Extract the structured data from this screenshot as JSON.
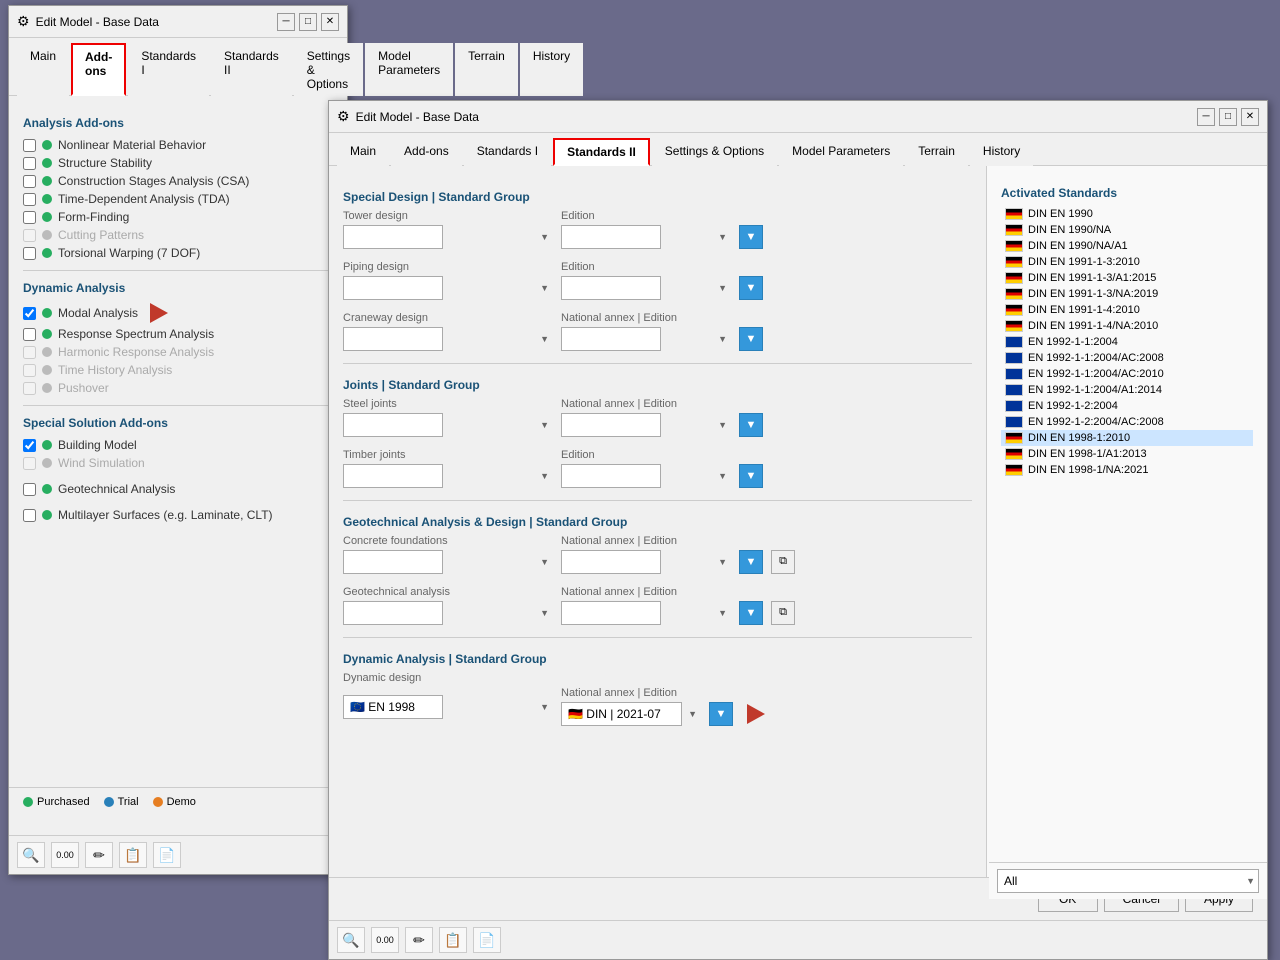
{
  "window1": {
    "title": "Edit Model - Base Data",
    "tabs": [
      "Main",
      "Add-ons",
      "Standards I",
      "Standards II",
      "Settings & Options",
      "Model Parameters",
      "Terrain",
      "History"
    ],
    "active_tab": "Add-ons",
    "sections": {
      "analysis_addons": {
        "heading": "Analysis Add-ons",
        "items": [
          {
            "label": "Nonlinear Material Behavior",
            "checked": false,
            "enabled": true,
            "dot": "green"
          },
          {
            "label": "Structure Stability",
            "checked": false,
            "enabled": true,
            "dot": "green"
          },
          {
            "label": "Construction Stages Analysis (CSA)",
            "checked": false,
            "enabled": true,
            "dot": "green"
          },
          {
            "label": "Time-Dependent Analysis (TDA)",
            "checked": false,
            "enabled": true,
            "dot": "green"
          },
          {
            "label": "Form-Finding",
            "checked": false,
            "enabled": true,
            "dot": "green"
          },
          {
            "label": "Cutting Patterns",
            "checked": false,
            "enabled": false,
            "dot": "gray"
          },
          {
            "label": "Torsional Warping (7 DOF)",
            "checked": false,
            "enabled": true,
            "dot": "green"
          }
        ]
      },
      "dynamic_analysis": {
        "heading": "Dynamic Analysis",
        "items": [
          {
            "label": "Modal Analysis",
            "checked": true,
            "enabled": true,
            "dot": "green",
            "arrow": true
          },
          {
            "label": "Response Spectrum Analysis",
            "checked": false,
            "enabled": true,
            "dot": "green"
          },
          {
            "label": "Harmonic Response Analysis",
            "checked": false,
            "enabled": false,
            "dot": "gray"
          },
          {
            "label": "Time History Analysis",
            "checked": false,
            "enabled": false,
            "dot": "gray"
          },
          {
            "label": "Pushover",
            "checked": false,
            "enabled": false,
            "dot": "gray"
          }
        ]
      },
      "special_addons": {
        "heading": "Special Solution Add-ons",
        "items": [
          {
            "label": "Building Model",
            "checked": true,
            "enabled": true,
            "dot": "green"
          },
          {
            "label": "Wind Simulation",
            "checked": false,
            "enabled": false,
            "dot": "gray"
          },
          {
            "label": "Geotechnical Analysis",
            "checked": false,
            "enabled": true,
            "dot": "green"
          },
          {
            "label": "Multilayer Surfaces (e.g. Laminate, CLT)",
            "checked": false,
            "enabled": true,
            "dot": "green"
          }
        ]
      }
    },
    "legend": {
      "items": [
        {
          "label": "Purchased",
          "color": "#27ae60"
        },
        {
          "label": "Trial",
          "color": "#2980b9"
        },
        {
          "label": "Demo",
          "color": "#e67e22"
        }
      ]
    }
  },
  "window2": {
    "title": "Edit Model - Base Data",
    "tabs": [
      "Main",
      "Add-ons",
      "Standards I",
      "Standards II",
      "Settings & Options",
      "Model Parameters",
      "Terrain",
      "History"
    ],
    "active_tab": "Standards II",
    "sections": {
      "special_design": {
        "heading": "Special Design | Standard Group",
        "tower_design": {
          "label": "Tower design",
          "edition_label": "Edition"
        },
        "piping_design": {
          "label": "Piping design",
          "edition_label": "Edition"
        },
        "craneway_design": {
          "label": "Craneway design",
          "national_annex_label": "National annex | Edition"
        }
      },
      "joints": {
        "heading": "Joints | Standard Group",
        "steel_joints": {
          "label": "Steel joints",
          "national_annex_label": "National annex | Edition"
        },
        "timber_joints": {
          "label": "Timber joints",
          "edition_label": "Edition"
        }
      },
      "geotechnical": {
        "heading": "Geotechnical Analysis & Design | Standard Group",
        "concrete_foundations": {
          "label": "Concrete foundations",
          "national_annex_label": "National annex | Edition"
        },
        "geotechnical_analysis": {
          "label": "Geotechnical analysis",
          "national_annex_label": "National annex | Edition"
        }
      },
      "dynamic_analysis": {
        "heading": "Dynamic Analysis | Standard Group",
        "dynamic_design": {
          "label": "Dynamic design",
          "national_annex_label": "National annex | Edition",
          "standard_value": "EN 1998",
          "annex_value": "DIN | 2021-07",
          "arrow": true
        }
      }
    },
    "activated_standards": {
      "heading": "Activated Standards",
      "items": [
        {
          "label": "DIN EN 1990",
          "flag": "de"
        },
        {
          "label": "DIN EN 1990/NA",
          "flag": "de"
        },
        {
          "label": "DIN EN 1990/NA/A1",
          "flag": "de"
        },
        {
          "label": "DIN EN 1991-1-3:2010",
          "flag": "de"
        },
        {
          "label": "DIN EN 1991-1-3/A1:2015",
          "flag": "de"
        },
        {
          "label": "DIN EN 1991-1-3/NA:2019",
          "flag": "de"
        },
        {
          "label": "DIN EN 1991-1-4:2010",
          "flag": "de"
        },
        {
          "label": "DIN EN 1991-1-4/NA:2010",
          "flag": "de"
        },
        {
          "label": "EN 1992-1-1:2004",
          "flag": "eu"
        },
        {
          "label": "EN 1992-1-1:2004/AC:2008",
          "flag": "eu"
        },
        {
          "label": "EN 1992-1-1:2004/AC:2010",
          "flag": "eu"
        },
        {
          "label": "EN 1992-1-1:2004/A1:2014",
          "flag": "eu"
        },
        {
          "label": "EN 1992-1-2:2004",
          "flag": "eu"
        },
        {
          "label": "EN 1992-1-2:2004/AC:2008",
          "flag": "eu"
        },
        {
          "label": "DIN EN 1998-1:2010",
          "flag": "de",
          "highlighted": true
        },
        {
          "label": "DIN EN 1998-1/A1:2013",
          "flag": "de"
        },
        {
          "label": "DIN EN 1998-1/NA:2021",
          "flag": "de"
        }
      ],
      "filter_dropdown": "All"
    },
    "buttons": {
      "ok": "OK",
      "cancel": "Cancel",
      "apply": "Apply"
    }
  }
}
